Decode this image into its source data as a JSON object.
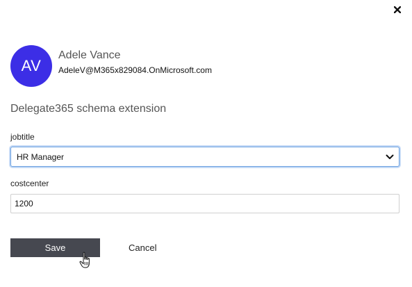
{
  "dialog": {
    "close_icon": "close-icon"
  },
  "user": {
    "initials": "AV",
    "name": "Adele Vance",
    "email": "AdeleV@M365x829084.OnMicrosoft.com",
    "avatar_color": "#3c2ee6"
  },
  "section": {
    "title": "Delegate365 schema extension"
  },
  "fields": {
    "jobtitle": {
      "label": "jobtitle",
      "value": "HR Manager"
    },
    "costcenter": {
      "label": "costcenter",
      "value": "1200"
    }
  },
  "actions": {
    "save_label": "Save",
    "cancel_label": "Cancel",
    "save_color": "#464850"
  }
}
